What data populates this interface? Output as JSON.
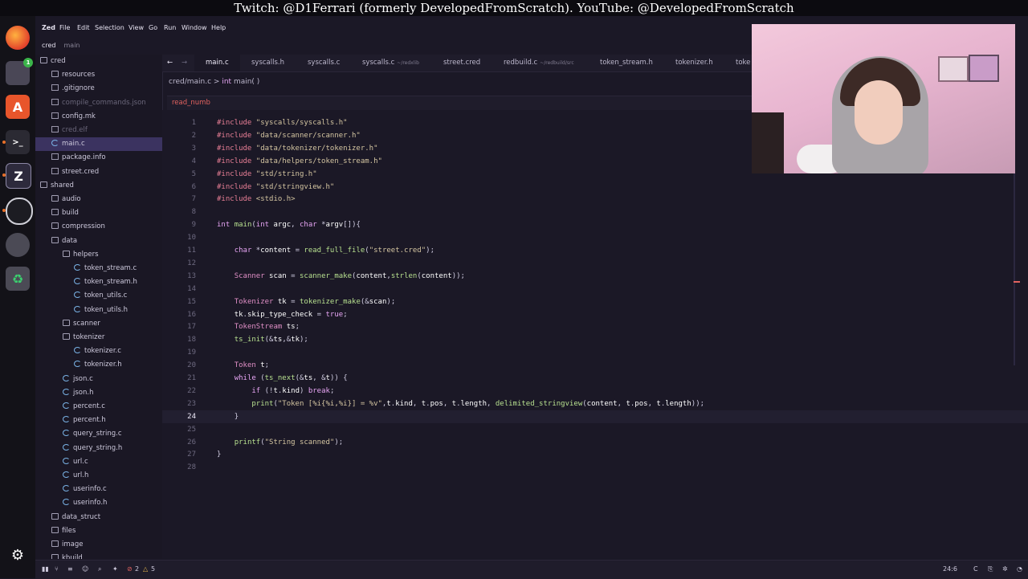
{
  "banner": "Twitch: @D1Ferrari (formerly DevelopedFromScratch). YouTube: @DevelopedFromScratch",
  "menu": [
    "Zed",
    "File",
    "Edit",
    "Selection",
    "View",
    "Go",
    "Run",
    "Window",
    "Help"
  ],
  "project": {
    "name": "cred",
    "branch": "main"
  },
  "sidebar": {
    "items": [
      {
        "label": "cred",
        "kind": "folder"
      },
      {
        "label": "resources",
        "kind": "folder"
      },
      {
        "label": ".gitignore",
        "kind": "gear"
      },
      {
        "label": "compile_commands.json",
        "kind": "file"
      },
      {
        "label": "config.mk",
        "kind": "file"
      },
      {
        "label": "cred.elf",
        "kind": "file"
      },
      {
        "label": "main.c",
        "kind": "c"
      },
      {
        "label": "package.info",
        "kind": "file"
      },
      {
        "label": "street.cred",
        "kind": "file"
      },
      {
        "label": "shared",
        "kind": "folder"
      },
      {
        "label": "audio",
        "kind": "folder"
      },
      {
        "label": "build",
        "kind": "folder"
      },
      {
        "label": "compression",
        "kind": "folder"
      },
      {
        "label": "data",
        "kind": "folder"
      },
      {
        "label": "helpers",
        "kind": "folder"
      },
      {
        "label": "token_stream.c",
        "kind": "c"
      },
      {
        "label": "token_stream.h",
        "kind": "c"
      },
      {
        "label": "token_utils.c",
        "kind": "c"
      },
      {
        "label": "token_utils.h",
        "kind": "c"
      },
      {
        "label": "scanner",
        "kind": "folder"
      },
      {
        "label": "tokenizer",
        "kind": "folder"
      },
      {
        "label": "tokenizer.c",
        "kind": "c"
      },
      {
        "label": "tokenizer.h",
        "kind": "c"
      },
      {
        "label": "json.c",
        "kind": "c"
      },
      {
        "label": "json.h",
        "kind": "c"
      },
      {
        "label": "percent.c",
        "kind": "c"
      },
      {
        "label": "percent.h",
        "kind": "c"
      },
      {
        "label": "query_string.c",
        "kind": "c"
      },
      {
        "label": "query_string.h",
        "kind": "c"
      },
      {
        "label": "url.c",
        "kind": "c"
      },
      {
        "label": "url.h",
        "kind": "c"
      },
      {
        "label": "userinfo.c",
        "kind": "c"
      },
      {
        "label": "userinfo.h",
        "kind": "c"
      },
      {
        "label": "data_struct",
        "kind": "folder"
      },
      {
        "label": "files",
        "kind": "folder"
      },
      {
        "label": "image",
        "kind": "folder"
      },
      {
        "label": "kbuild",
        "kind": "folder"
      }
    ]
  },
  "tabs": [
    {
      "label": "main.c",
      "sub": ""
    },
    {
      "label": "syscalls.h",
      "sub": ""
    },
    {
      "label": "syscalls.c",
      "sub": ""
    },
    {
      "label": "syscalls.c",
      "sub": "~/redxlib"
    },
    {
      "label": "street.cred",
      "sub": ""
    },
    {
      "label": "redbuild.c",
      "sub": "~/redbuild/src"
    },
    {
      "label": "token_stream.h",
      "sub": ""
    },
    {
      "label": "tokenizer.h",
      "sub": ""
    },
    {
      "label": "toke",
      "sub": ""
    }
  ],
  "breadcrumb": {
    "path": "cred/main.c",
    "sep": ">",
    "kw": "int",
    "fn": "main( )"
  },
  "search": {
    "value": "read_numb"
  },
  "code": {
    "line_numbers": [
      "1",
      "2",
      "3",
      "4",
      "5",
      "6",
      "7",
      "8",
      "9",
      "10",
      "11",
      "12",
      "13",
      "14",
      "15",
      "16",
      "17",
      "18",
      "19",
      "20",
      "21",
      "22",
      "23",
      "24",
      "25",
      "26",
      "27",
      "28"
    ],
    "current_line": "24",
    "lines": [
      "#include \"syscalls/syscalls.h\"",
      "#include \"data/scanner/scanner.h\"",
      "#include \"data/tokenizer/tokenizer.h\"",
      "#include \"data/helpers/token_stream.h\"",
      "#include \"std/string.h\"",
      "#include \"std/stringview.h\"",
      "#include <stdio.h>",
      "",
      "int main(int argc, char *argv[]){",
      "",
      "    char *content = read_full_file(\"street.cred\");",
      "",
      "    Scanner scan = scanner_make(content,strlen(content));",
      "",
      "    Tokenizer tk = tokenizer_make(&scan);",
      "    tk.skip_type_check = true;",
      "    TokenStream ts;",
      "    ts_init(&ts,&tk);",
      "",
      "    Token t;",
      "    while (ts_next(&ts, &t)) {",
      "        if (!t.kind) break;",
      "        print(\"Token [%i{%i,%i}] = %v\",t.kind, t.pos, t.length, delimited_stringview(content, t.pos, t.length));",
      "    }",
      "",
      "    printf(\"String scanned\");",
      "}",
      ""
    ]
  },
  "status": {
    "cursor": "24:6",
    "lang": "C",
    "errors": "2",
    "warnings": "5"
  },
  "dock": {
    "badge": "1"
  }
}
